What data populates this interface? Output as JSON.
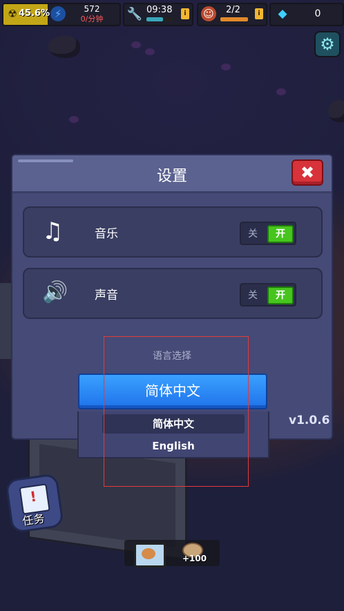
{
  "hud": {
    "radiation_percent": "45.6%",
    "energy_value": "572",
    "energy_rate": "0/分钟",
    "timer": "09:38",
    "timer_badge": "i",
    "workers": "2/2",
    "workers_badge": "i",
    "gems": "0"
  },
  "settings": {
    "title": "设置",
    "music_label": "音乐",
    "sound_label": "声音",
    "toggle_off_label": "关",
    "toggle_on_label": "开",
    "music_state": "开",
    "sound_state": "开",
    "language_title": "语言选择",
    "language_selected": "简体中文",
    "language_options": [
      "简体中文",
      "English"
    ],
    "version": "v1.0.6"
  },
  "bottom": {
    "task_label": "任务",
    "reward_label": "+100"
  },
  "icons": {
    "radiation": "radiation-icon",
    "energy": "lightning-icon",
    "timer": "wrench-icon",
    "workers": "worker-avatar-icon",
    "gems": "diamond-icon",
    "settings": "gear-icon",
    "close": "close-icon",
    "music": "music-note-icon",
    "sound": "speaker-icon"
  },
  "colors": {
    "toggle_on": "#47c51e",
    "close_button": "#d8323a",
    "language_button": "#2a86f5",
    "annotation_box": "#e23b3b"
  }
}
